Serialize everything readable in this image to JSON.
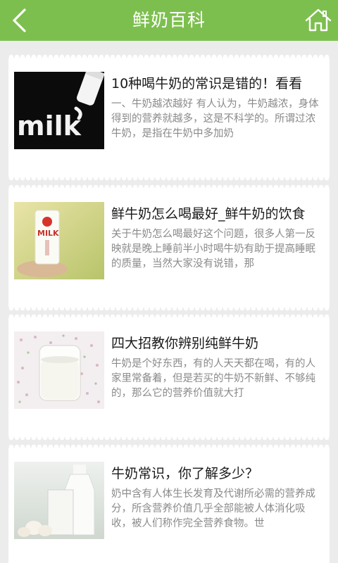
{
  "header": {
    "title": "鲜奶百科",
    "back_icon": "chevron-left-icon",
    "home_icon": "home-icon",
    "bar_color": "#7dbf4f"
  },
  "articles": [
    {
      "title": "10种喝牛奶的常识是错的！看看",
      "desc": "一、牛奶越浓越好 有人认为，牛奶越浓，身体得到的营养就越多，这是不科学的。所谓过浓牛奶，是指在牛奶中多加奶",
      "image_text": "milk"
    },
    {
      "title": "鲜牛奶怎么喝最好_鲜牛奶的饮食",
      "desc": "关于牛奶怎么喝最好这个问题，很多人第一反映就是晚上睡前半小时喝牛奶有助于提高睡眠的质量，当然大家没有说错，那",
      "image_text": "MILK"
    },
    {
      "title": "四大招教你辨别纯鲜牛奶",
      "desc": "牛奶是个好东西，有的人天天都在喝，有的人家里常备着，但是若买的牛奶不新鲜、不够纯的，那么它的营养价值就大打",
      "image_text": ""
    },
    {
      "title": "牛奶常识，你了解多少？",
      "desc": "奶中含有人体生长发育及代谢所必需的营养成分，所含营养价值几乎全部能被人体消化吸收，被人们称作完全营养食物。世",
      "image_text": ""
    }
  ]
}
